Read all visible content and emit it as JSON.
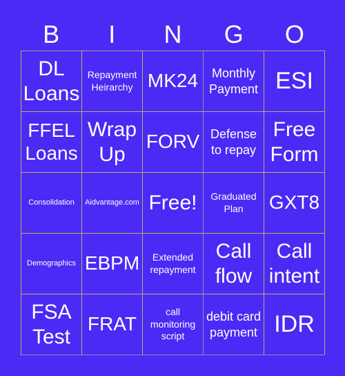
{
  "header": {
    "letters": [
      "B",
      "I",
      "N",
      "G",
      "O"
    ]
  },
  "board": {
    "cells": [
      "DL Loans",
      "Repayment Heirarchy",
      "MK24",
      "Monthly Payment",
      "ESI",
      "FFEL Loans",
      "Wrap Up",
      "FORV",
      "Defense to repay",
      "Free Form",
      "Consolidation",
      "Aidvantage.com",
      "Free!",
      "Graduated Plan",
      "GXT8",
      "Demographics",
      "EBPM",
      "Extended repayment",
      "Call flow",
      "Call intent",
      "FSA Test",
      "FRAT",
      "call monitoring script",
      "debit card payment",
      "IDR"
    ]
  },
  "colors": {
    "background": "#4a2af4",
    "text": "#ffffff",
    "grid_line": "#c2ad6a"
  }
}
